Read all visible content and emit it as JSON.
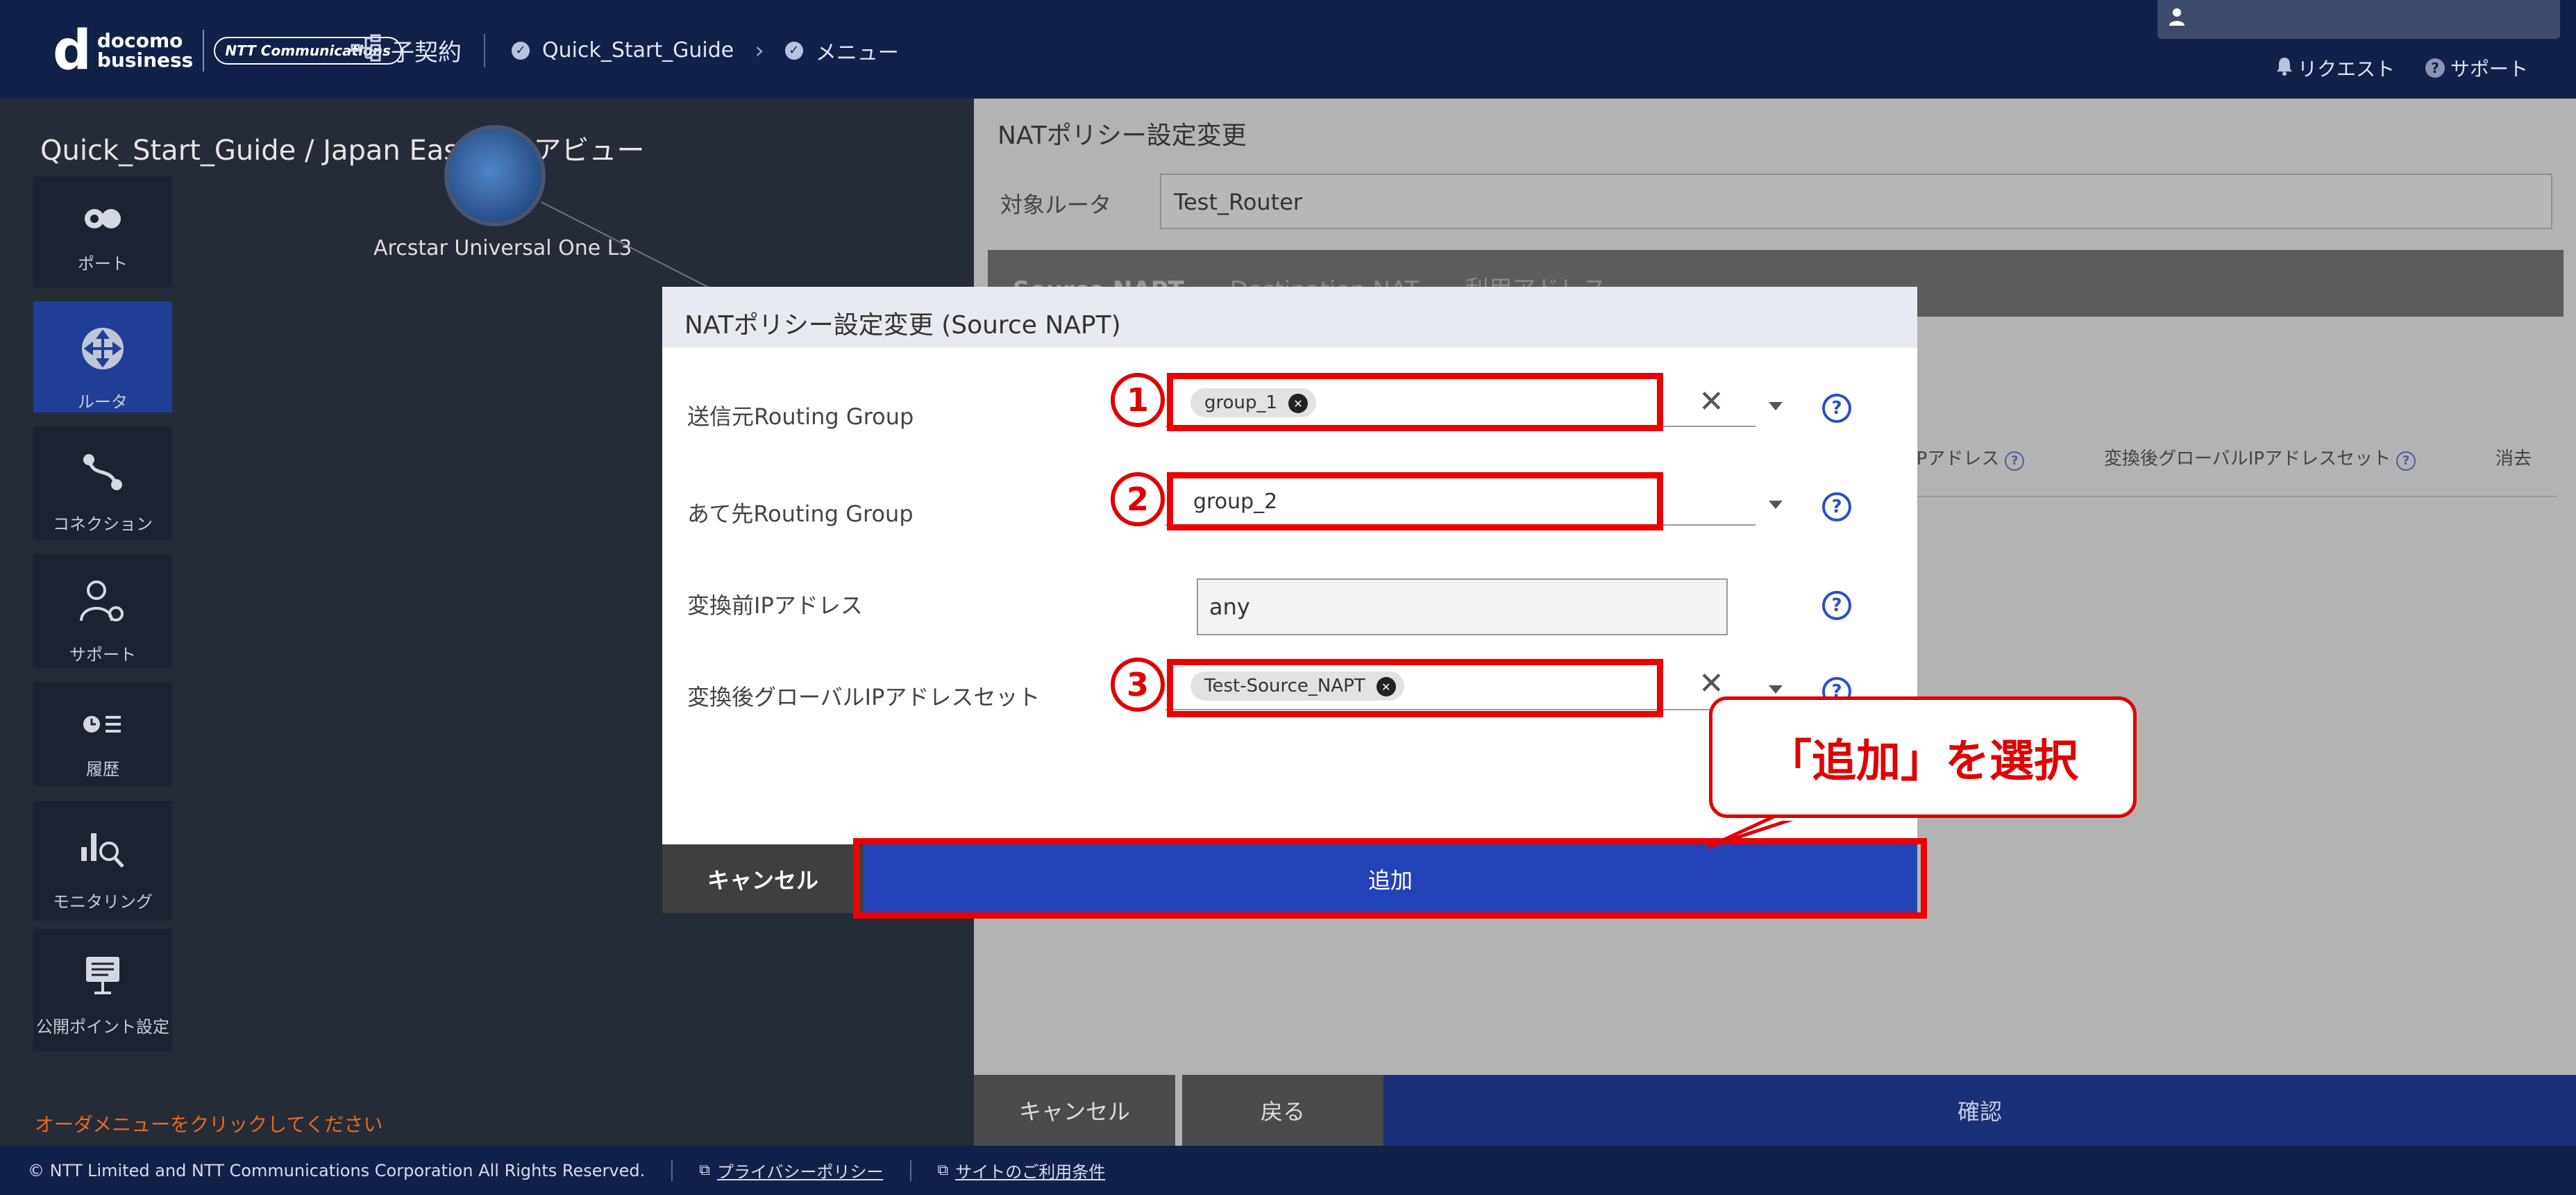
{
  "header": {
    "logo_line1": "docomo",
    "logo_line2": "business",
    "ntt_logo": "NTT Communications",
    "crumb_contract": "子契約",
    "crumb_guide": "Quick_Start_Guide",
    "crumb_menu": "メニュー",
    "request": "リクエスト",
    "support": "サポート"
  },
  "left": {
    "area_title": "Quick_Start_Guide / Japan East エリアビュー",
    "node_label": "Arcstar Universal One L3",
    "sidebar": [
      {
        "label": "ポート",
        "icon": "port-icon"
      },
      {
        "label": "ルータ",
        "icon": "router-icon"
      },
      {
        "label": "コネクション",
        "icon": "connection-icon"
      },
      {
        "label": "サポート",
        "icon": "support-icon"
      },
      {
        "label": "履歴",
        "icon": "history-icon"
      },
      {
        "label": "モニタリング",
        "icon": "monitoring-icon"
      },
      {
        "label": "公開ポイント設定",
        "icon": "public-point-icon"
      }
    ],
    "hint": "オーダメニューをクリックしてください"
  },
  "right": {
    "title": "NATポリシー設定変更",
    "router_label": "対象ルータ",
    "router_value": "Test_Router",
    "tabs": [
      "Source NAPT",
      "Destination NAT",
      "利用アドレス"
    ],
    "col_ip": "IPアドレス",
    "col_global_set": "変換後グローバルIPアドレスセット",
    "col_delete": "消去",
    "cancel": "キャンセル",
    "back": "戻る",
    "confirm": "確認"
  },
  "modal": {
    "title": "NATポリシー設定変更 (Source NAPT)",
    "src_label": "送信元Routing Group",
    "src_chip": "group_1",
    "dst_label": "あて先Routing Group",
    "dst_value": "group_2",
    "pre_ip_label": "変換前IPアドレス",
    "pre_ip_value": "any",
    "post_ip_label": "変換後グローバルIPアドレスセット",
    "post_chip": "Test-Source_NAPT",
    "cancel": "キャンセル",
    "add": "追加"
  },
  "annotations": {
    "step1": "1",
    "step2": "2",
    "step3": "3",
    "callout": "「追加」を選択"
  },
  "footer": {
    "copyright": "© NTT Limited and NTT Communications Corporation All Rights Reserved.",
    "privacy": "プライバシーポリシー",
    "terms": "サイトのご利用条件"
  },
  "colors": {
    "header_bg": "#12214a",
    "primary_blue": "#2342b8",
    "annotation_red": "#ee0000",
    "hint_orange": "#e36b21"
  }
}
